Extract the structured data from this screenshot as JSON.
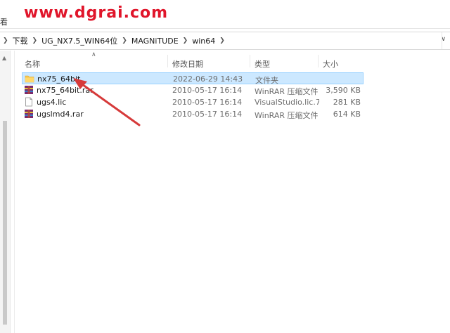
{
  "watermark": "www.dgrai.com",
  "ribbon_stub": "看",
  "address": {
    "crumbs": [
      "下载",
      "UG_NX7.5_WIN64位",
      "MAGNiTUDE",
      "win64"
    ]
  },
  "columns": {
    "name": "名称",
    "date": "修改日期",
    "type": "类型",
    "size": "大小"
  },
  "files": [
    {
      "name": "nx75_64bit",
      "date": "2022-06-29 14:43",
      "type": "文件夹",
      "size": "",
      "icon": "folder-icon",
      "selected": true
    },
    {
      "name": "nx75_64bit.rar",
      "date": "2010-05-17 16:14",
      "type": "WinRAR 压缩文件",
      "size": "3,590 KB",
      "icon": "winrar-archive-icon",
      "selected": false
    },
    {
      "name": "ugs4.lic",
      "date": "2010-05-17 16:14",
      "type": "VisualStudio.lic.7...",
      "size": "281 KB",
      "icon": "document-icon",
      "selected": false
    },
    {
      "name": "ugslmd4.rar",
      "date": "2010-05-17 16:14",
      "type": "WinRAR 压缩文件",
      "size": "614 KB",
      "icon": "winrar-archive-icon",
      "selected": false
    }
  ],
  "colors": {
    "watermark": "#e0152a",
    "selection_bg": "#cce8ff",
    "selection_border": "#99d1ff",
    "arrow": "#d63a3a"
  }
}
